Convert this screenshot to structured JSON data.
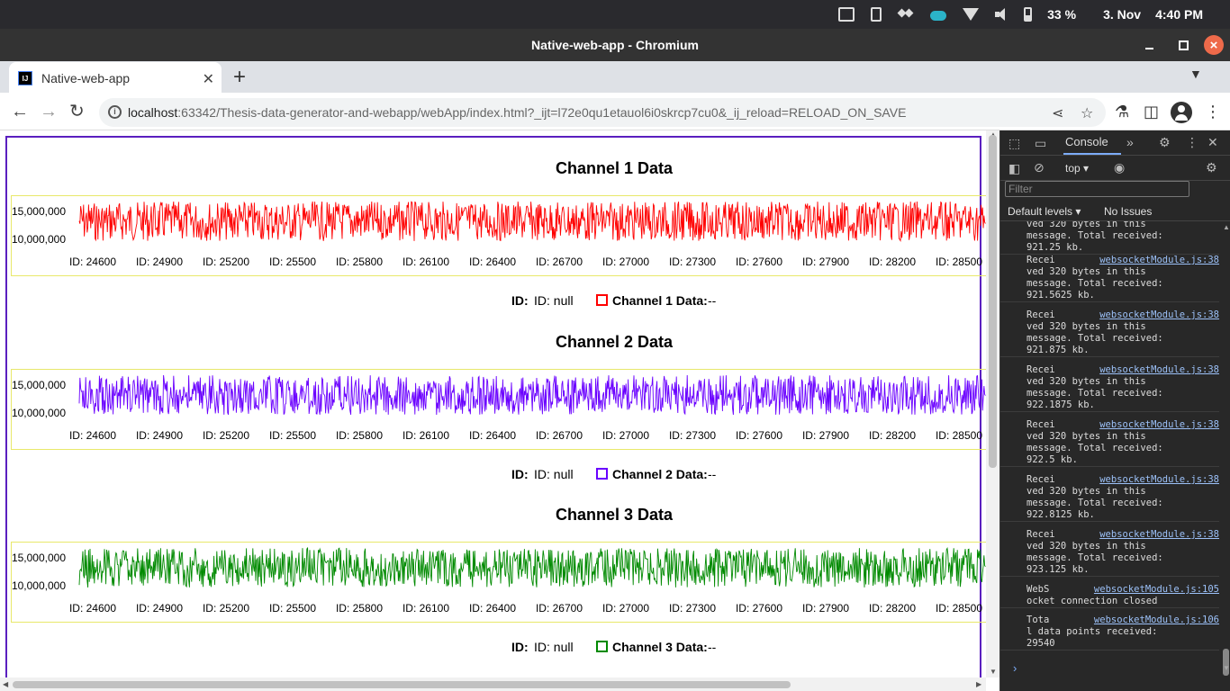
{
  "os": {
    "battery": "33 %",
    "date": "3. Nov",
    "time": "4:40 PM"
  },
  "window": {
    "title": "Native-web-app - Chromium"
  },
  "tab": {
    "title": "Native-web-app",
    "favicon": "IJ"
  },
  "address": {
    "host": "localhost",
    "rest": ":63342/Thesis-data-generator-and-webapp/webApp/index.html?_ijt=l72e0qu1etauol6i0skrcp7cu0&_ij_reload=RELOAD_ON_SAVE"
  },
  "x_ticks": [
    "ID: 24600",
    "ID: 24900",
    "ID: 25200",
    "ID: 25500",
    "ID: 25800",
    "ID: 26100",
    "ID: 26400",
    "ID: 26700",
    "ID: 27000",
    "ID: 27300",
    "ID: 27600",
    "ID: 27900",
    "ID: 28200",
    "ID: 28500"
  ],
  "y_ticks": [
    "15,000,000",
    "10,000,000"
  ],
  "channels": [
    {
      "title": "Channel 1 Data",
      "color": "#ff0000",
      "id_label": "ID:",
      "id_value": "ID: null",
      "data_label": "Channel 1 Data:",
      "data_value": "--"
    },
    {
      "title": "Channel 2 Data",
      "color": "#6a00ff",
      "id_label": "ID:",
      "id_value": "ID: null",
      "data_label": "Channel 2 Data:",
      "data_value": "--"
    },
    {
      "title": "Channel 3 Data",
      "color": "#008a00",
      "id_label": "ID:",
      "id_value": "ID: null",
      "data_label": "Channel 3 Data:",
      "data_value": "--"
    }
  ],
  "devtools": {
    "tab": "Console",
    "context": "top",
    "filter_placeholder": "Filter",
    "levels": "Default levels ▾",
    "issues": "No Issues",
    "messages": [
      {
        "lines": [
          "ved 320 bytes in this",
          "message. Total received:",
          "921.25 kb."
        ],
        "src": ""
      },
      {
        "lines": [
          "Recei",
          "ved 320 bytes in this",
          "message. Total received:",
          "921.5625 kb."
        ],
        "src": "websocketModule.js:38"
      },
      {
        "lines": [
          "Recei",
          "ved 320 bytes in this",
          "message. Total received:",
          "921.875 kb."
        ],
        "src": "websocketModule.js:38"
      },
      {
        "lines": [
          "Recei",
          "ved 320 bytes in this",
          "message. Total received:",
          "922.1875 kb."
        ],
        "src": "websocketModule.js:38"
      },
      {
        "lines": [
          "Recei",
          "ved 320 bytes in this",
          "message. Total received:",
          "922.5 kb."
        ],
        "src": "websocketModule.js:38"
      },
      {
        "lines": [
          "Recei",
          "ved 320 bytes in this",
          "message. Total received:",
          "922.8125 kb."
        ],
        "src": "websocketModule.js:38"
      },
      {
        "lines": [
          "Recei",
          "ved 320 bytes in this",
          "message. Total received:",
          "923.125 kb."
        ],
        "src": "websocketModule.js:38"
      },
      {
        "lines": [
          "WebS",
          "ocket connection closed"
        ],
        "src": "websocketModule.js:105"
      },
      {
        "lines": [
          "Tota",
          "l data points received:",
          "29540"
        ],
        "src": "websocketModule.js:106"
      }
    ],
    "prompt": "›"
  }
}
